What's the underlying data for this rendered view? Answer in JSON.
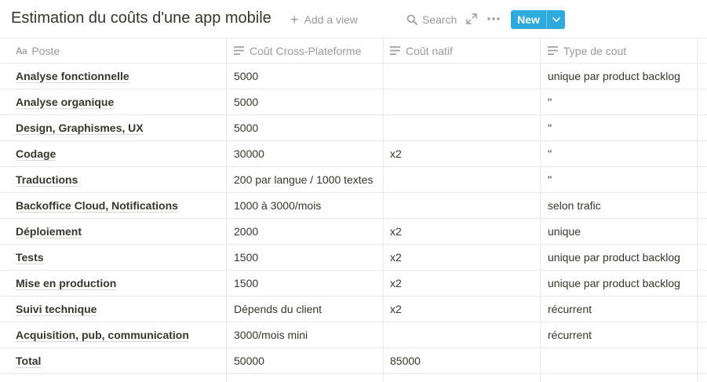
{
  "header": {
    "title": "Estimation du coûts d'une app mobile",
    "add_view": "Add a view",
    "search": "Search",
    "new_label": "New"
  },
  "columns": [
    {
      "label": "Poste",
      "icon": "title-icon"
    },
    {
      "label": "Coût Cross-Plateforme",
      "icon": "text-icon"
    },
    {
      "label": "Coût natif",
      "icon": "text-icon"
    },
    {
      "label": "Type de cout",
      "icon": "text-icon"
    }
  ],
  "rows": [
    {
      "poste": "Analyse fonctionnelle",
      "cross": "5000",
      "natif": "",
      "type": "unique par product backlog"
    },
    {
      "poste": "Analyse organique",
      "cross": "5000",
      "natif": "",
      "type": "''"
    },
    {
      "poste": "Design, Graphismes, UX",
      "cross": "5000",
      "natif": "",
      "type": "''"
    },
    {
      "poste": "Codage",
      "cross": "30000",
      "natif": "x2",
      "type": "''"
    },
    {
      "poste": "Traductions",
      "cross": "200 par langue / 1000 textes",
      "natif": "",
      "type": "''"
    },
    {
      "poste": "Backoffice Cloud, Notifications",
      "cross": "1000 à 3000/mois",
      "natif": "",
      "type": "selon trafic"
    },
    {
      "poste": "Déploiement",
      "cross": "2000",
      "natif": "x2",
      "type": "unique"
    },
    {
      "poste": "Tests",
      "cross": "1500",
      "natif": "x2",
      "type": "unique par product backlog"
    },
    {
      "poste": "Mise en production",
      "cross": "1500",
      "natif": "x2",
      "type": "unique par product backlog"
    },
    {
      "poste": "Suivi technique",
      "cross": "Dépends du client",
      "natif": "x2",
      "type": "récurrent"
    },
    {
      "poste": "Acquisition, pub, communication",
      "cross": "3000/mois mini",
      "natif": "",
      "type": "récurrent"
    },
    {
      "poste": "Total",
      "cross": "50000",
      "natif": "85000",
      "type": ""
    }
  ],
  "colors": {
    "accent": "#2eaadc",
    "text": "#37352f",
    "muted": "#9b9a97",
    "border": "#e9e9e7"
  }
}
